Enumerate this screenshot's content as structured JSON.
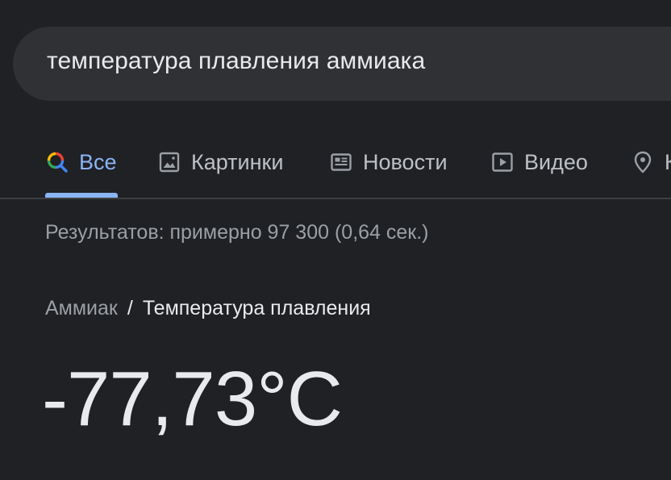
{
  "search": {
    "query": "температура плавления аммиака"
  },
  "tabs": [
    {
      "label": "Все",
      "icon": "search-icon",
      "active": true
    },
    {
      "label": "Картинки",
      "icon": "image-icon",
      "active": false
    },
    {
      "label": "Новости",
      "icon": "newspaper-icon",
      "active": false
    },
    {
      "label": "Видео",
      "icon": "play-icon",
      "active": false
    },
    {
      "label": "К",
      "icon": "map-pin-icon",
      "active": false
    }
  ],
  "results": {
    "stats": "Результатов: примерно 97 300 (0,64 сек.)"
  },
  "answer": {
    "breadcrumb_parent": "Аммиак",
    "breadcrumb_separator": "/",
    "breadcrumb_current": "Температура плавления",
    "value": "-77,73°C"
  },
  "colors": {
    "background": "#202124",
    "search_bar": "#303134",
    "accent": "#8ab4f8",
    "text_primary": "#e8eaed",
    "text_secondary": "#9aa0a6"
  }
}
